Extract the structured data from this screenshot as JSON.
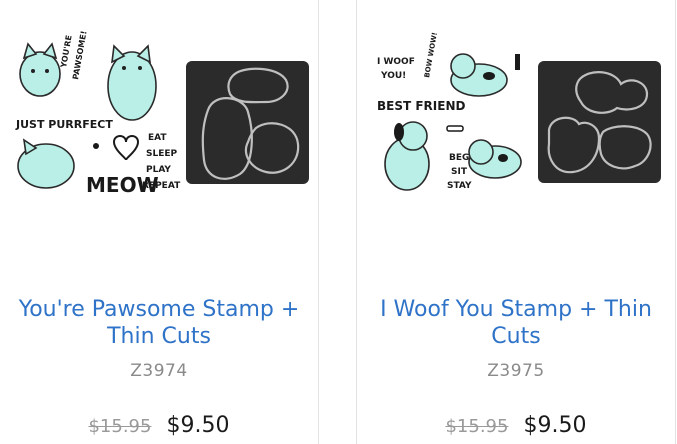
{
  "products": [
    {
      "title": "You're Pawsome Stamp + Thin Cuts",
      "sku": "Z3974",
      "old_price": "$15.95",
      "price": "$9.50",
      "stamp_words": [
        "YOU'RE",
        "PAWSOME!",
        "JUST PURRFECT",
        "MEOW",
        "EAT",
        "SLEEP",
        "PLAY",
        "REPEAT"
      ]
    },
    {
      "title": "I Woof You Stamp + Thin Cuts",
      "sku": "Z3975",
      "old_price": "$15.95",
      "price": "$9.50",
      "stamp_words": [
        "I WOOF",
        "YOU!",
        "BOW WOW!",
        "BEST FRIEND",
        "BEG",
        "SIT",
        "STAY"
      ]
    }
  ],
  "colors": {
    "title_link": "#2f73c8",
    "stamp_mint": "#b9efe6",
    "die_plate": "#2b2b2b"
  }
}
